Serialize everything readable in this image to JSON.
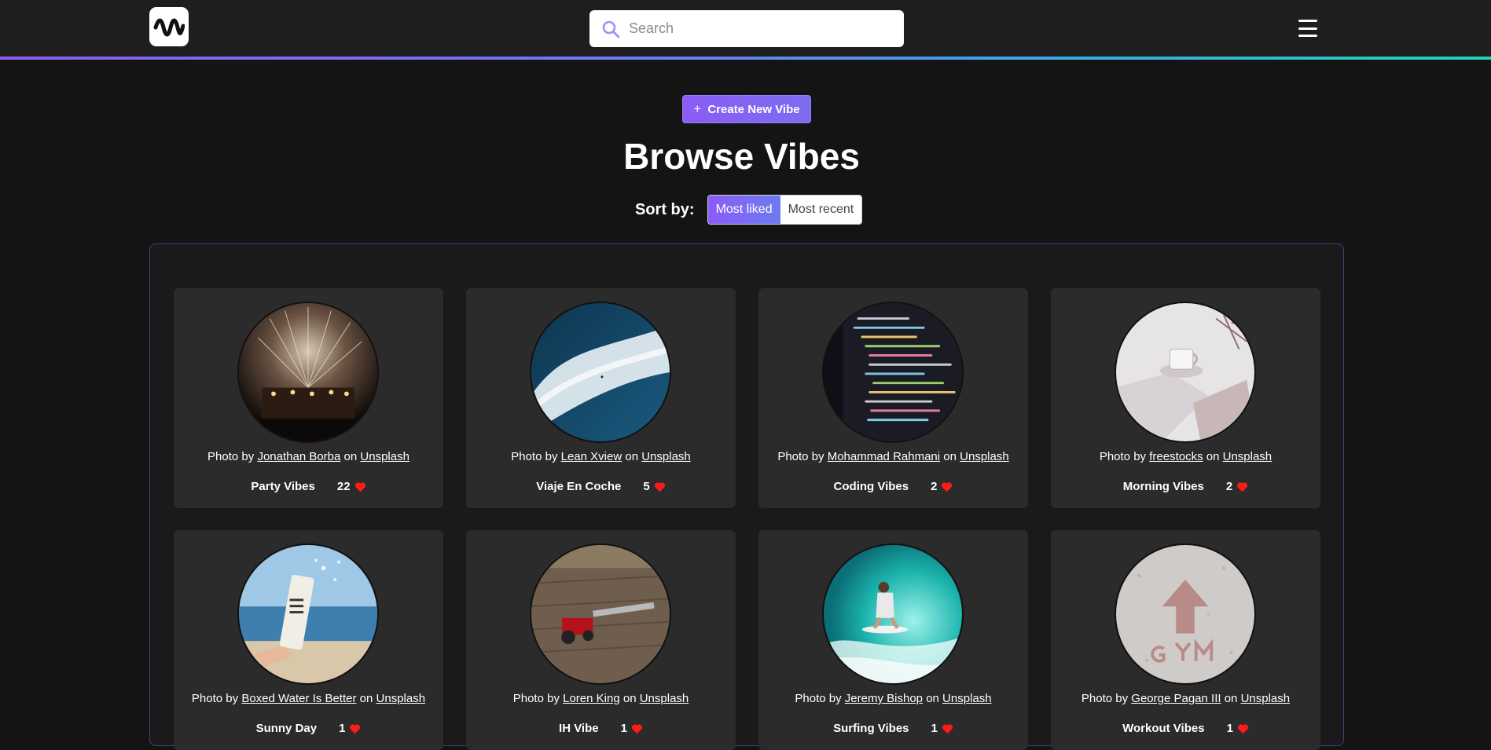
{
  "header": {
    "search_placeholder": "Search",
    "accent_gradient": [
      "#8b5cf6",
      "#22d3b4"
    ]
  },
  "hero": {
    "create_label": "Create New Vibe",
    "title": "Browse Vibes",
    "sort_label": "Sort by:",
    "sort_options": [
      "Most liked",
      "Most recent"
    ],
    "sort_selected": "Most liked"
  },
  "credit": {
    "prefix": "Photo by",
    "on": "on",
    "source": "Unsplash"
  },
  "vibes": [
    {
      "name": "Party Vibes",
      "likes": "22",
      "photographer": "Jonathan Borba",
      "image": "concert-fireworks"
    },
    {
      "name": "Viaje En Coche",
      "likes": "5",
      "photographer": "Lean Xview",
      "image": "sky-clouds"
    },
    {
      "name": "Coding Vibes",
      "likes": "2",
      "photographer": "Mohammad Rahmani",
      "image": "code-screen"
    },
    {
      "name": "Morning Vibes",
      "likes": "2",
      "photographer": "freestocks",
      "image": "coffee-book"
    },
    {
      "name": "Sunny Day",
      "likes": "1",
      "photographer": "Boxed Water Is Better",
      "image": "beach-carton"
    },
    {
      "name": "IH Vibe",
      "likes": "1",
      "photographer": "Loren King",
      "image": "tractor-field"
    },
    {
      "name": "Surfing Vibes",
      "likes": "1",
      "photographer": "Jeremy Bishop",
      "image": "surfer-wave"
    },
    {
      "name": "Workout Vibes",
      "likes": "1",
      "photographer": "George Pagan III",
      "image": "gym-floor"
    }
  ],
  "colors": {
    "heart": "#ff1a1a",
    "card_bg": "#2b2b2b",
    "page_bg": "#141414"
  }
}
